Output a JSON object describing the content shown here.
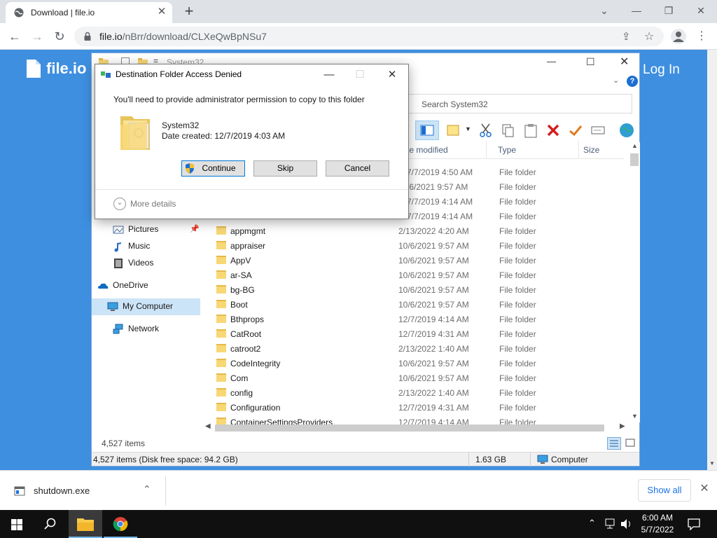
{
  "browser": {
    "tab_title": "Download | file.io",
    "url_host": "file.io",
    "url_path": "/nBrr/download/CLXeQwBpNSu7"
  },
  "site": {
    "brand": "file.io",
    "login": "Log In"
  },
  "explorer": {
    "title": "System32",
    "search_placeholder": "Search System32",
    "columns": [
      "te modified",
      "Type",
      "Size"
    ],
    "nav": [
      {
        "label": "Pictures",
        "icon": "pictures-icon"
      },
      {
        "label": "Music",
        "icon": "music-icon"
      },
      {
        "label": "Videos",
        "icon": "videos-icon"
      },
      {
        "label": "OneDrive",
        "icon": "onedrive-icon"
      },
      {
        "label": "My Computer",
        "icon": "computer-icon"
      },
      {
        "label": "Network",
        "icon": "network-icon"
      }
    ],
    "rows": [
      {
        "name": "",
        "date": "7/7/2019 4:50 AM",
        "type": "File folder"
      },
      {
        "name": "",
        "date": "/6/2021 9:57 AM",
        "type": "File folder"
      },
      {
        "name": "",
        "date": "7/7/2019 4:14 AM",
        "type": "File folder"
      },
      {
        "name": "",
        "date": "7/7/2019 4:14 AM",
        "type": "File folder"
      },
      {
        "name": "appmgmt",
        "date": "2/13/2022 4:20 AM",
        "type": "File folder"
      },
      {
        "name": "appraiser",
        "date": "10/6/2021 9:57 AM",
        "type": "File folder"
      },
      {
        "name": "AppV",
        "date": "10/6/2021 9:57 AM",
        "type": "File folder"
      },
      {
        "name": "ar-SA",
        "date": "10/6/2021 9:57 AM",
        "type": "File folder"
      },
      {
        "name": "bg-BG",
        "date": "10/6/2021 9:57 AM",
        "type": "File folder"
      },
      {
        "name": "Boot",
        "date": "10/6/2021 9:57 AM",
        "type": "File folder"
      },
      {
        "name": "Bthprops",
        "date": "12/7/2019 4:14 AM",
        "type": "File folder"
      },
      {
        "name": "CatRoot",
        "date": "12/7/2019 4:31 AM",
        "type": "File folder"
      },
      {
        "name": "catroot2",
        "date": "2/13/2022 1:40 AM",
        "type": "File folder"
      },
      {
        "name": "CodeIntegrity",
        "date": "10/6/2021 9:57 AM",
        "type": "File folder"
      },
      {
        "name": "Com",
        "date": "10/6/2021 9:57 AM",
        "type": "File folder"
      },
      {
        "name": "config",
        "date": "2/13/2022 1:40 AM",
        "type": "File folder"
      },
      {
        "name": "Configuration",
        "date": "12/7/2019 4:31 AM",
        "type": "File folder"
      },
      {
        "name": "ContainerSettingsProviders",
        "date": "12/7/2019 4:14 AM",
        "type": "File folder"
      }
    ],
    "item_count": "4,527 items",
    "status_left": "4,527 items (Disk free space: 94.2 GB)",
    "status_size": "1.63 GB",
    "status_location": "Computer"
  },
  "dialog": {
    "title": "Destination Folder Access Denied",
    "message": "You'll need to provide administrator permission to copy to this folder",
    "folder_name": "System32",
    "folder_date": "Date created: 12/7/2019 4:03 AM",
    "continue": "Continue",
    "skip": "Skip",
    "cancel": "Cancel",
    "more_details": "More details"
  },
  "downloads": {
    "file": "shutdown.exe",
    "show_all": "Show all"
  },
  "taskbar": {
    "time": "6:00 AM",
    "date": "5/7/2022"
  }
}
